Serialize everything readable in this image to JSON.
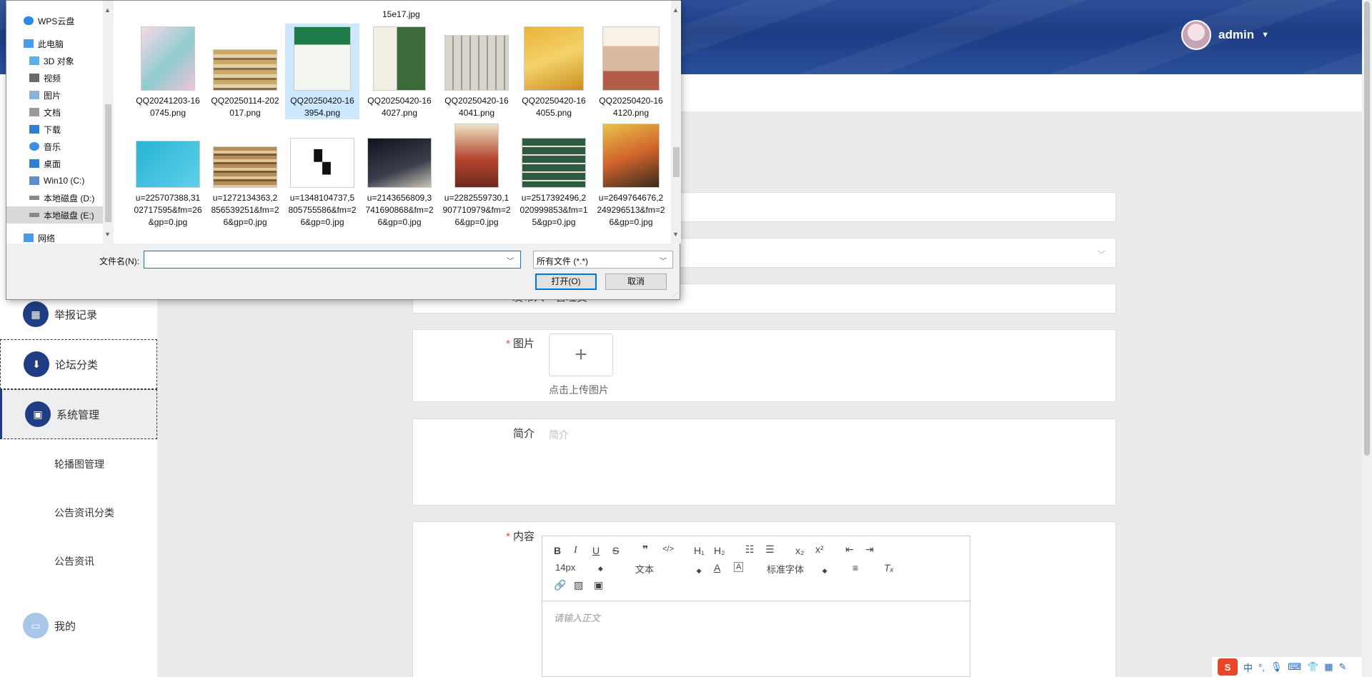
{
  "header": {
    "username": "admin"
  },
  "sidebar": {
    "items": [
      {
        "label": "举报记录"
      },
      {
        "label": "论坛分类"
      },
      {
        "label": "系统管理"
      },
      {
        "label": "我的"
      }
    ],
    "sub_items": [
      {
        "label": "轮播图管理"
      },
      {
        "label": "公告资讯分类"
      },
      {
        "label": "公告资讯"
      }
    ]
  },
  "form": {
    "publisher_label": "发布人",
    "publisher_value": "管理员",
    "image_label": "图片",
    "upload_plus": "+",
    "upload_hint": "点击上传图片",
    "intro_label": "简介",
    "intro_placeholder": "简介",
    "content_label": "内容",
    "editor": {
      "font_size": "14px",
      "block_type": "文本",
      "font_family": "标准字体",
      "placeholder": "请输入正文"
    }
  },
  "dialog": {
    "nav": [
      {
        "label": "WPS云盘",
        "icon": "cloud-icon"
      },
      {
        "label": "此电脑",
        "icon": "computer-icon"
      },
      {
        "label": "3D 对象",
        "icon": "cube-icon"
      },
      {
        "label": "视频",
        "icon": "video-icon"
      },
      {
        "label": "图片",
        "icon": "picture-icon"
      },
      {
        "label": "文档",
        "icon": "document-icon"
      },
      {
        "label": "下载",
        "icon": "download-icon"
      },
      {
        "label": "音乐",
        "icon": "music-icon"
      },
      {
        "label": "桌面",
        "icon": "desktop-icon"
      },
      {
        "label": "Win10 (C:)",
        "icon": "drive-icon"
      },
      {
        "label": "本地磁盘 (D:)",
        "icon": "drive-icon"
      },
      {
        "label": "本地磁盘 (E:)",
        "icon": "drive-icon"
      },
      {
        "label": "网络",
        "icon": "network-icon"
      }
    ],
    "partial_top_caption": "15e17.jpg",
    "files_row1": [
      {
        "name": "QQ20241203-160745.png"
      },
      {
        "name": "QQ20250114-202017.png"
      },
      {
        "name": "QQ20250420-163954.png"
      },
      {
        "name": "QQ20250420-164027.png"
      },
      {
        "name": "QQ20250420-164041.png"
      },
      {
        "name": "QQ20250420-164055.png"
      },
      {
        "name": "QQ20250420-164120.png"
      }
    ],
    "files_row2": [
      {
        "name": "u=225707388,3102717595&fm=26&gp=0.jpg"
      },
      {
        "name": "u=1272134363,2856539251&fm=26&gp=0.jpg"
      },
      {
        "name": "u=1348104737,5805755586&fm=26&gp=0.jpg"
      },
      {
        "name": "u=2143656809,3741690868&fm=26&gp=0.jpg"
      },
      {
        "name": "u=2282559730,1907710979&fm=26&gp=0.jpg"
      },
      {
        "name": "u=2517392496,2020999853&fm=15&gp=0.jpg"
      },
      {
        "name": "u=2649764676,2249296513&fm=26&gp=0.jpg"
      }
    ],
    "filename_label": "文件名(N):",
    "filename_value": "",
    "filetype_value": "所有文件 (*.*)",
    "open_label": "打开(O)",
    "cancel_label": "取消"
  },
  "taskbar": {
    "ime_logo": "S",
    "ime_mode": "中"
  }
}
